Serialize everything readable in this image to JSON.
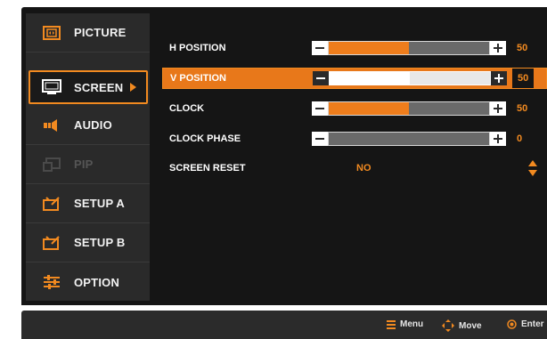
{
  "sidebar": {
    "items": [
      {
        "label": "PICTURE",
        "icon": "picture-icon"
      },
      {
        "label": "SCREEN",
        "icon": "screen-icon",
        "selected": true
      },
      {
        "label": "AUDIO",
        "icon": "audio-icon"
      },
      {
        "label": "PIP",
        "icon": "pip-icon",
        "disabled": true
      },
      {
        "label": "SETUP A",
        "icon": "setup-icon"
      },
      {
        "label": "SETUP B",
        "icon": "setup-icon"
      },
      {
        "label": "OPTION",
        "icon": "option-icon"
      }
    ]
  },
  "screen_menu": {
    "rows": [
      {
        "label": "H POSITION",
        "value": "50",
        "level": 0.5
      },
      {
        "label": "V POSITION",
        "value": "50",
        "level": 0.5,
        "selected": true
      },
      {
        "label": "CLOCK",
        "value": "50",
        "level": 0.5
      },
      {
        "label": "CLOCK PHASE",
        "value": "0",
        "level": 0.0
      }
    ],
    "reset": {
      "label": "SCREEN RESET",
      "value": "NO"
    }
  },
  "footer": {
    "menu": "Menu",
    "move": "Move",
    "enter": "Enter"
  },
  "colors": {
    "accent": "#f28a20",
    "panel": "#151515",
    "sidebar": "#2a2a2a"
  }
}
